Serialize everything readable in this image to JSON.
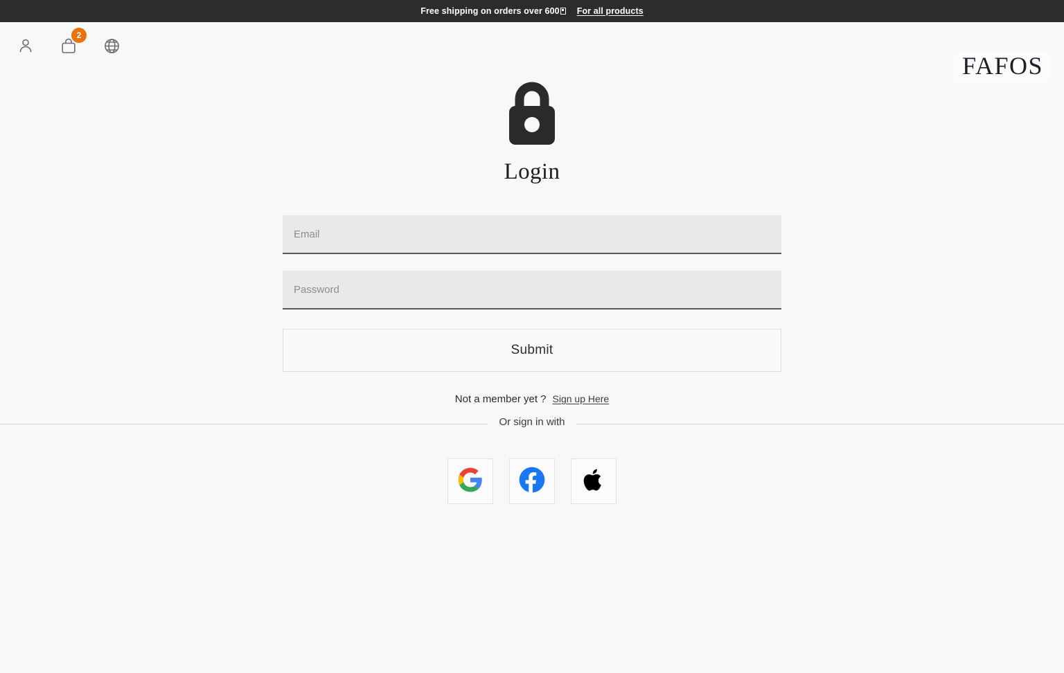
{
  "announcement": {
    "text": "Free shipping on orders over 600",
    "currency_glyph": "missing-glyph-box",
    "link_label": "For all products"
  },
  "header": {
    "icons": [
      {
        "name": "account-icon",
        "label": "Account"
      },
      {
        "name": "cart-icon",
        "label": "Cart",
        "badge": "2"
      },
      {
        "name": "globe-icon",
        "label": "Language"
      }
    ],
    "cart_badge_count": "2",
    "badge_color": "#e8720c",
    "brand": "FAFOS"
  },
  "login": {
    "lock_icon": "lock-icon",
    "title": "Login",
    "email": {
      "placeholder": "Email",
      "value": ""
    },
    "password": {
      "placeholder": "Password",
      "value": ""
    },
    "submit_label": "Submit",
    "signup_prompt": "Not a member yet ?",
    "signup_link": "Sign up Here"
  },
  "social": {
    "divider_label": "Or sign in with",
    "providers": [
      {
        "name": "google",
        "label": "Sign in with Google"
      },
      {
        "name": "facebook",
        "label": "Sign in with Facebook"
      },
      {
        "name": "apple",
        "label": "Sign in with Apple"
      }
    ]
  },
  "colors": {
    "page_background": "#f7f8f9",
    "announcement_background": "#2c2c2c",
    "badge": "#e8720c",
    "input_background": "#e8e9ea",
    "google_red": "#ea4335",
    "google_blue": "#4285f4",
    "google_yellow": "#fbbc05",
    "google_green": "#34a853",
    "facebook_blue": "#1877f2",
    "apple_black": "#000000"
  }
}
